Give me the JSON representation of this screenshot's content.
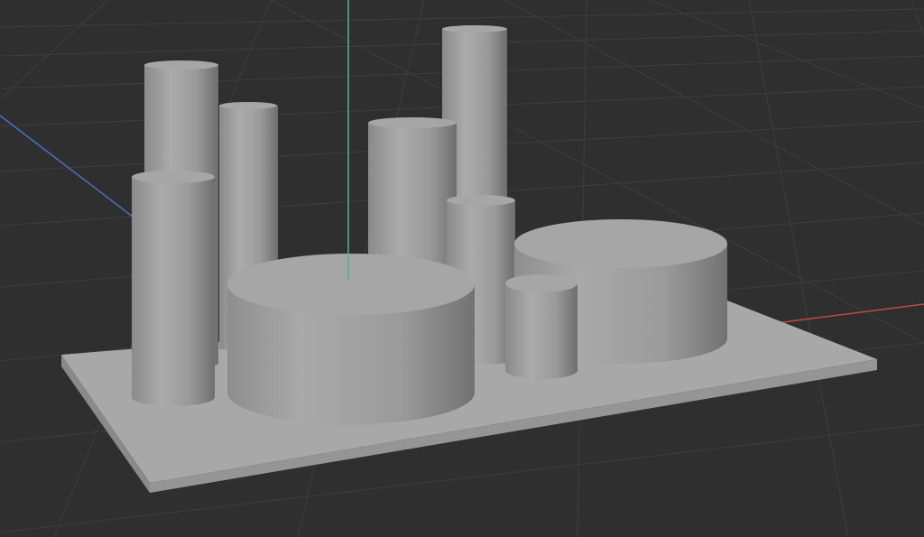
{
  "app": {
    "view": "3D viewport"
  },
  "colors": {
    "background": "#2f2f2f",
    "grid_line": "#3f3f3f",
    "axis_x": "#c04a4a",
    "axis_y": "#4a6fc0",
    "axis_z": "#5fb07a",
    "object_light": "#a9a9a9",
    "object_top": "#a4a4a4",
    "object_dark": "#6f6f6f",
    "base_top": "#a7a7a7",
    "base_side": "#8a8a8a"
  },
  "scene": {
    "object_type": "cylinder",
    "object_count": 9,
    "base": "plate"
  }
}
